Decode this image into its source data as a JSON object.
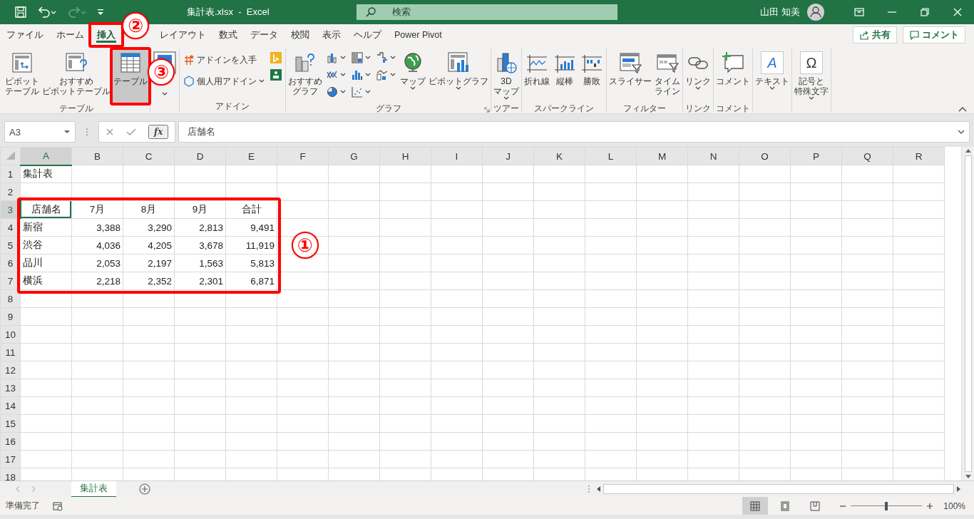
{
  "title_bar": {
    "title": "集計表.xlsx  -  Excel",
    "search_placeholder": "検索",
    "user_name": "山田 知美"
  },
  "tabs": [
    {
      "label": "ファイル",
      "selected": false
    },
    {
      "label": "ホーム",
      "selected": false
    },
    {
      "label": "挿入",
      "selected": true
    },
    {
      "label": "レイアウト",
      "selected": false
    },
    {
      "label": "数式",
      "selected": false
    },
    {
      "label": "データ",
      "selected": false
    },
    {
      "label": "校閲",
      "selected": false
    },
    {
      "label": "表示",
      "selected": false
    },
    {
      "label": "ヘルプ",
      "selected": false
    },
    {
      "label": "Power Pivot",
      "selected": false
    }
  ],
  "tab_bar_buttons": [
    {
      "label": "共有"
    },
    {
      "label": "コメント"
    }
  ],
  "ribbon_groups": [
    {
      "label": "テーブル",
      "columns": [
        {
          "items": [
            {
              "kind": "large",
              "lines": [
                "ピボット",
                "テーブル"
              ],
              "dropdown": false,
              "highlighted": false
            }
          ]
        },
        {
          "items": [
            {
              "kind": "large",
              "lines": [
                "おすすめ",
                "ピボットテーブル"
              ],
              "dropdown": false,
              "highlighted": false
            }
          ]
        },
        {
          "items": [
            {
              "kind": "large",
              "lines": [
                "テーブル"
              ],
              "dropdown": false,
              "highlighted": true
            }
          ]
        }
      ]
    },
    {
      "columns": [
        {
          "items": [
            {
              "kind": "large",
              "dropdown": true,
              "highlighted": false
            }
          ]
        }
      ]
    },
    {
      "label": "アドイン",
      "columns": [
        {
          "items": [
            {
              "kind": "small",
              "lines": [
                "アドインを入手"
              ],
              "dropdown": false,
              "highlighted": false
            },
            {
              "kind": "small",
              "lines": [
                "個人用アドイン"
              ],
              "dropdown": true,
              "highlighted": false
            }
          ]
        },
        {
          "items": [
            {
              "kind": "icon",
              "dropdown": false,
              "highlighted": false
            },
            {
              "kind": "icon",
              "dropdown": false,
              "highlighted": false
            }
          ]
        }
      ]
    },
    {
      "label": "グラフ",
      "launcher": true,
      "columns": [
        {
          "items": [
            {
              "kind": "large",
              "lines": [
                "おすすめ",
                "グラフ"
              ],
              "dropdown": false,
              "highlighted": false
            }
          ]
        },
        {
          "items": [
            {
              "kind": "icon",
              "dropdown": true,
              "highlighted": false
            },
            {
              "kind": "icon",
              "dropdown": true,
              "highlighted": false
            },
            {
              "kind": "icon",
              "dropdown": true,
              "highlighted": false
            }
          ]
        },
        {
          "items": [
            {
              "kind": "icon",
              "dropdown": true,
              "highlighted": false
            },
            {
              "kind": "icon",
              "dropdown": true,
              "highlighted": false
            },
            {
              "kind": "icon",
              "dropdown": true,
              "highlighted": false
            }
          ]
        },
        {
          "items": [
            {
              "kind": "icon",
              "dropdown": true,
              "highlighted": false
            },
            {
              "kind": "icon",
              "dropdown": true,
              "highlighted": false
            }
          ]
        },
        {
          "items": [
            {
              "kind": "large",
              "lines": [
                "マップ"
              ],
              "dropdown": true,
              "highlighted": false
            }
          ]
        },
        {
          "items": [
            {
              "kind": "large",
              "lines": [
                "ピボットグラフ"
              ],
              "dropdown": true,
              "highlighted": false
            }
          ]
        }
      ]
    },
    {
      "label": "ツアー",
      "columns": [
        {
          "items": [
            {
              "kind": "large",
              "lines": [
                "3D",
                "マップ"
              ],
              "dropdown": true,
              "highlighted": false
            }
          ]
        }
      ]
    },
    {
      "label": "スパークライン",
      "columns": [
        {
          "items": [
            {
              "kind": "large",
              "lines": [
                "折れ線"
              ],
              "dropdown": false,
              "highlighted": false
            }
          ]
        },
        {
          "items": [
            {
              "kind": "large",
              "lines": [
                "縦棒"
              ],
              "dropdown": false,
              "highlighted": false
            }
          ]
        },
        {
          "items": [
            {
              "kind": "large",
              "lines": [
                "勝敗"
              ],
              "dropdown": false,
              "highlighted": false
            }
          ]
        }
      ]
    },
    {
      "label": "フィルター",
      "columns": [
        {
          "items": [
            {
              "kind": "large",
              "lines": [
                "スライサー"
              ],
              "dropdown": false,
              "highlighted": false
            }
          ]
        },
        {
          "items": [
            {
              "kind": "large",
              "lines": [
                "タイム",
                "ライン"
              ],
              "dropdown": false,
              "highlighted": false
            }
          ]
        }
      ]
    },
    {
      "label": "リンク",
      "columns": [
        {
          "items": [
            {
              "kind": "large",
              "lines": [
                "リンク"
              ],
              "dropdown": true,
              "highlighted": false
            }
          ]
        }
      ]
    },
    {
      "label": "コメント",
      "columns": [
        {
          "items": [
            {
              "kind": "large",
              "lines": [
                "コメント"
              ],
              "dropdown": false,
              "highlighted": false
            }
          ]
        }
      ]
    },
    {
      "columns": [
        {
          "items": [
            {
              "kind": "large",
              "glyph": "A",
              "lines": [
                "テキスト"
              ],
              "dropdown": true,
              "highlighted": false
            }
          ]
        }
      ]
    },
    {
      "columns": [
        {
          "items": [
            {
              "kind": "large",
              "glyph": "Ω",
              "lines": [
                "記号と",
                "特殊文字"
              ],
              "dropdown": true,
              "highlighted": false
            }
          ]
        }
      ]
    }
  ],
  "formula_bar": {
    "name_box": "A3",
    "insert_function": "fx",
    "formula": "店舗名"
  },
  "sheet": {
    "columns": [
      {
        "label": "A",
        "selected": true
      },
      {
        "label": "B",
        "selected": false
      },
      {
        "label": "C",
        "selected": false
      },
      {
        "label": "D",
        "selected": false
      },
      {
        "label": "E",
        "selected": false
      },
      {
        "label": "F",
        "selected": false
      },
      {
        "label": "G",
        "selected": false
      },
      {
        "label": "H",
        "selected": false
      },
      {
        "label": "I",
        "selected": false
      },
      {
        "label": "J",
        "selected": false
      },
      {
        "label": "K",
        "selected": false
      },
      {
        "label": "L",
        "selected": false
      },
      {
        "label": "M",
        "selected": false
      },
      {
        "label": "N",
        "selected": false
      },
      {
        "label": "O",
        "selected": false
      },
      {
        "label": "P",
        "selected": false
      },
      {
        "label": "Q",
        "selected": false
      },
      {
        "label": "R",
        "selected": false
      }
    ],
    "rows": [
      {
        "label": "1",
        "selected": false,
        "cells": [
          {
            "text": "集計表",
            "kind": "title"
          }
        ]
      },
      {
        "label": "2",
        "selected": false,
        "cells": []
      },
      {
        "label": "3",
        "selected": true,
        "cells": [
          {
            "text": "店舗名",
            "kind": "header"
          },
          {
            "text": "7月",
            "kind": "header"
          },
          {
            "text": "8月",
            "kind": "header"
          },
          {
            "text": "9月",
            "kind": "header"
          },
          {
            "text": "合計",
            "kind": "header"
          }
        ]
      },
      {
        "label": "4",
        "selected": false,
        "cells": [
          {
            "text": "新宿",
            "kind": "text"
          },
          {
            "text": "3,388",
            "kind": "number"
          },
          {
            "text": "3,290",
            "kind": "number"
          },
          {
            "text": "2,813",
            "kind": "number"
          },
          {
            "text": "9,491",
            "kind": "number"
          }
        ]
      },
      {
        "label": "5",
        "selected": false,
        "cells": [
          {
            "text": "渋谷",
            "kind": "text"
          },
          {
            "text": "4,036",
            "kind": "number"
          },
          {
            "text": "4,205",
            "kind": "number"
          },
          {
            "text": "3,678",
            "kind": "number"
          },
          {
            "text": "11,919",
            "kind": "number"
          }
        ]
      },
      {
        "label": "6",
        "selected": false,
        "cells": [
          {
            "text": "品川",
            "kind": "text"
          },
          {
            "text": "2,053",
            "kind": "number"
          },
          {
            "text": "2,197",
            "kind": "number"
          },
          {
            "text": "1,563",
            "kind": "number"
          },
          {
            "text": "5,813",
            "kind": "number"
          }
        ]
      },
      {
        "label": "7",
        "selected": false,
        "cells": [
          {
            "text": "横浜",
            "kind": "text"
          },
          {
            "text": "2,218",
            "kind": "number"
          },
          {
            "text": "2,352",
            "kind": "number"
          },
          {
            "text": "2,301",
            "kind": "number"
          },
          {
            "text": "6,871",
            "kind": "number"
          }
        ]
      },
      {
        "label": "8",
        "selected": false,
        "cells": []
      },
      {
        "label": "9",
        "selected": false,
        "cells": []
      },
      {
        "label": "10",
        "selected": false,
        "cells": []
      },
      {
        "label": "11",
        "selected": false,
        "cells": []
      },
      {
        "label": "12",
        "selected": false,
        "cells": []
      },
      {
        "label": "13",
        "selected": false,
        "cells": []
      },
      {
        "label": "14",
        "selected": false,
        "cells": []
      },
      {
        "label": "15",
        "selected": false,
        "cells": []
      },
      {
        "label": "16",
        "selected": false,
        "cells": []
      },
      {
        "label": "17",
        "selected": false,
        "cells": []
      },
      {
        "label": "18",
        "selected": false,
        "cells": []
      }
    ]
  },
  "sheet_tabs": [
    {
      "label": "集計表",
      "selected": true
    }
  ],
  "status_bar": {
    "status": "準備完了",
    "views": [
      {
        "selected": true
      },
      {
        "selected": false
      },
      {
        "selected": false
      }
    ],
    "zoom": {
      "level": 0.5,
      "reading": "100%"
    }
  },
  "annotations": [
    {
      "label": "①"
    },
    {
      "label": "②"
    },
    {
      "label": "③"
    }
  ]
}
